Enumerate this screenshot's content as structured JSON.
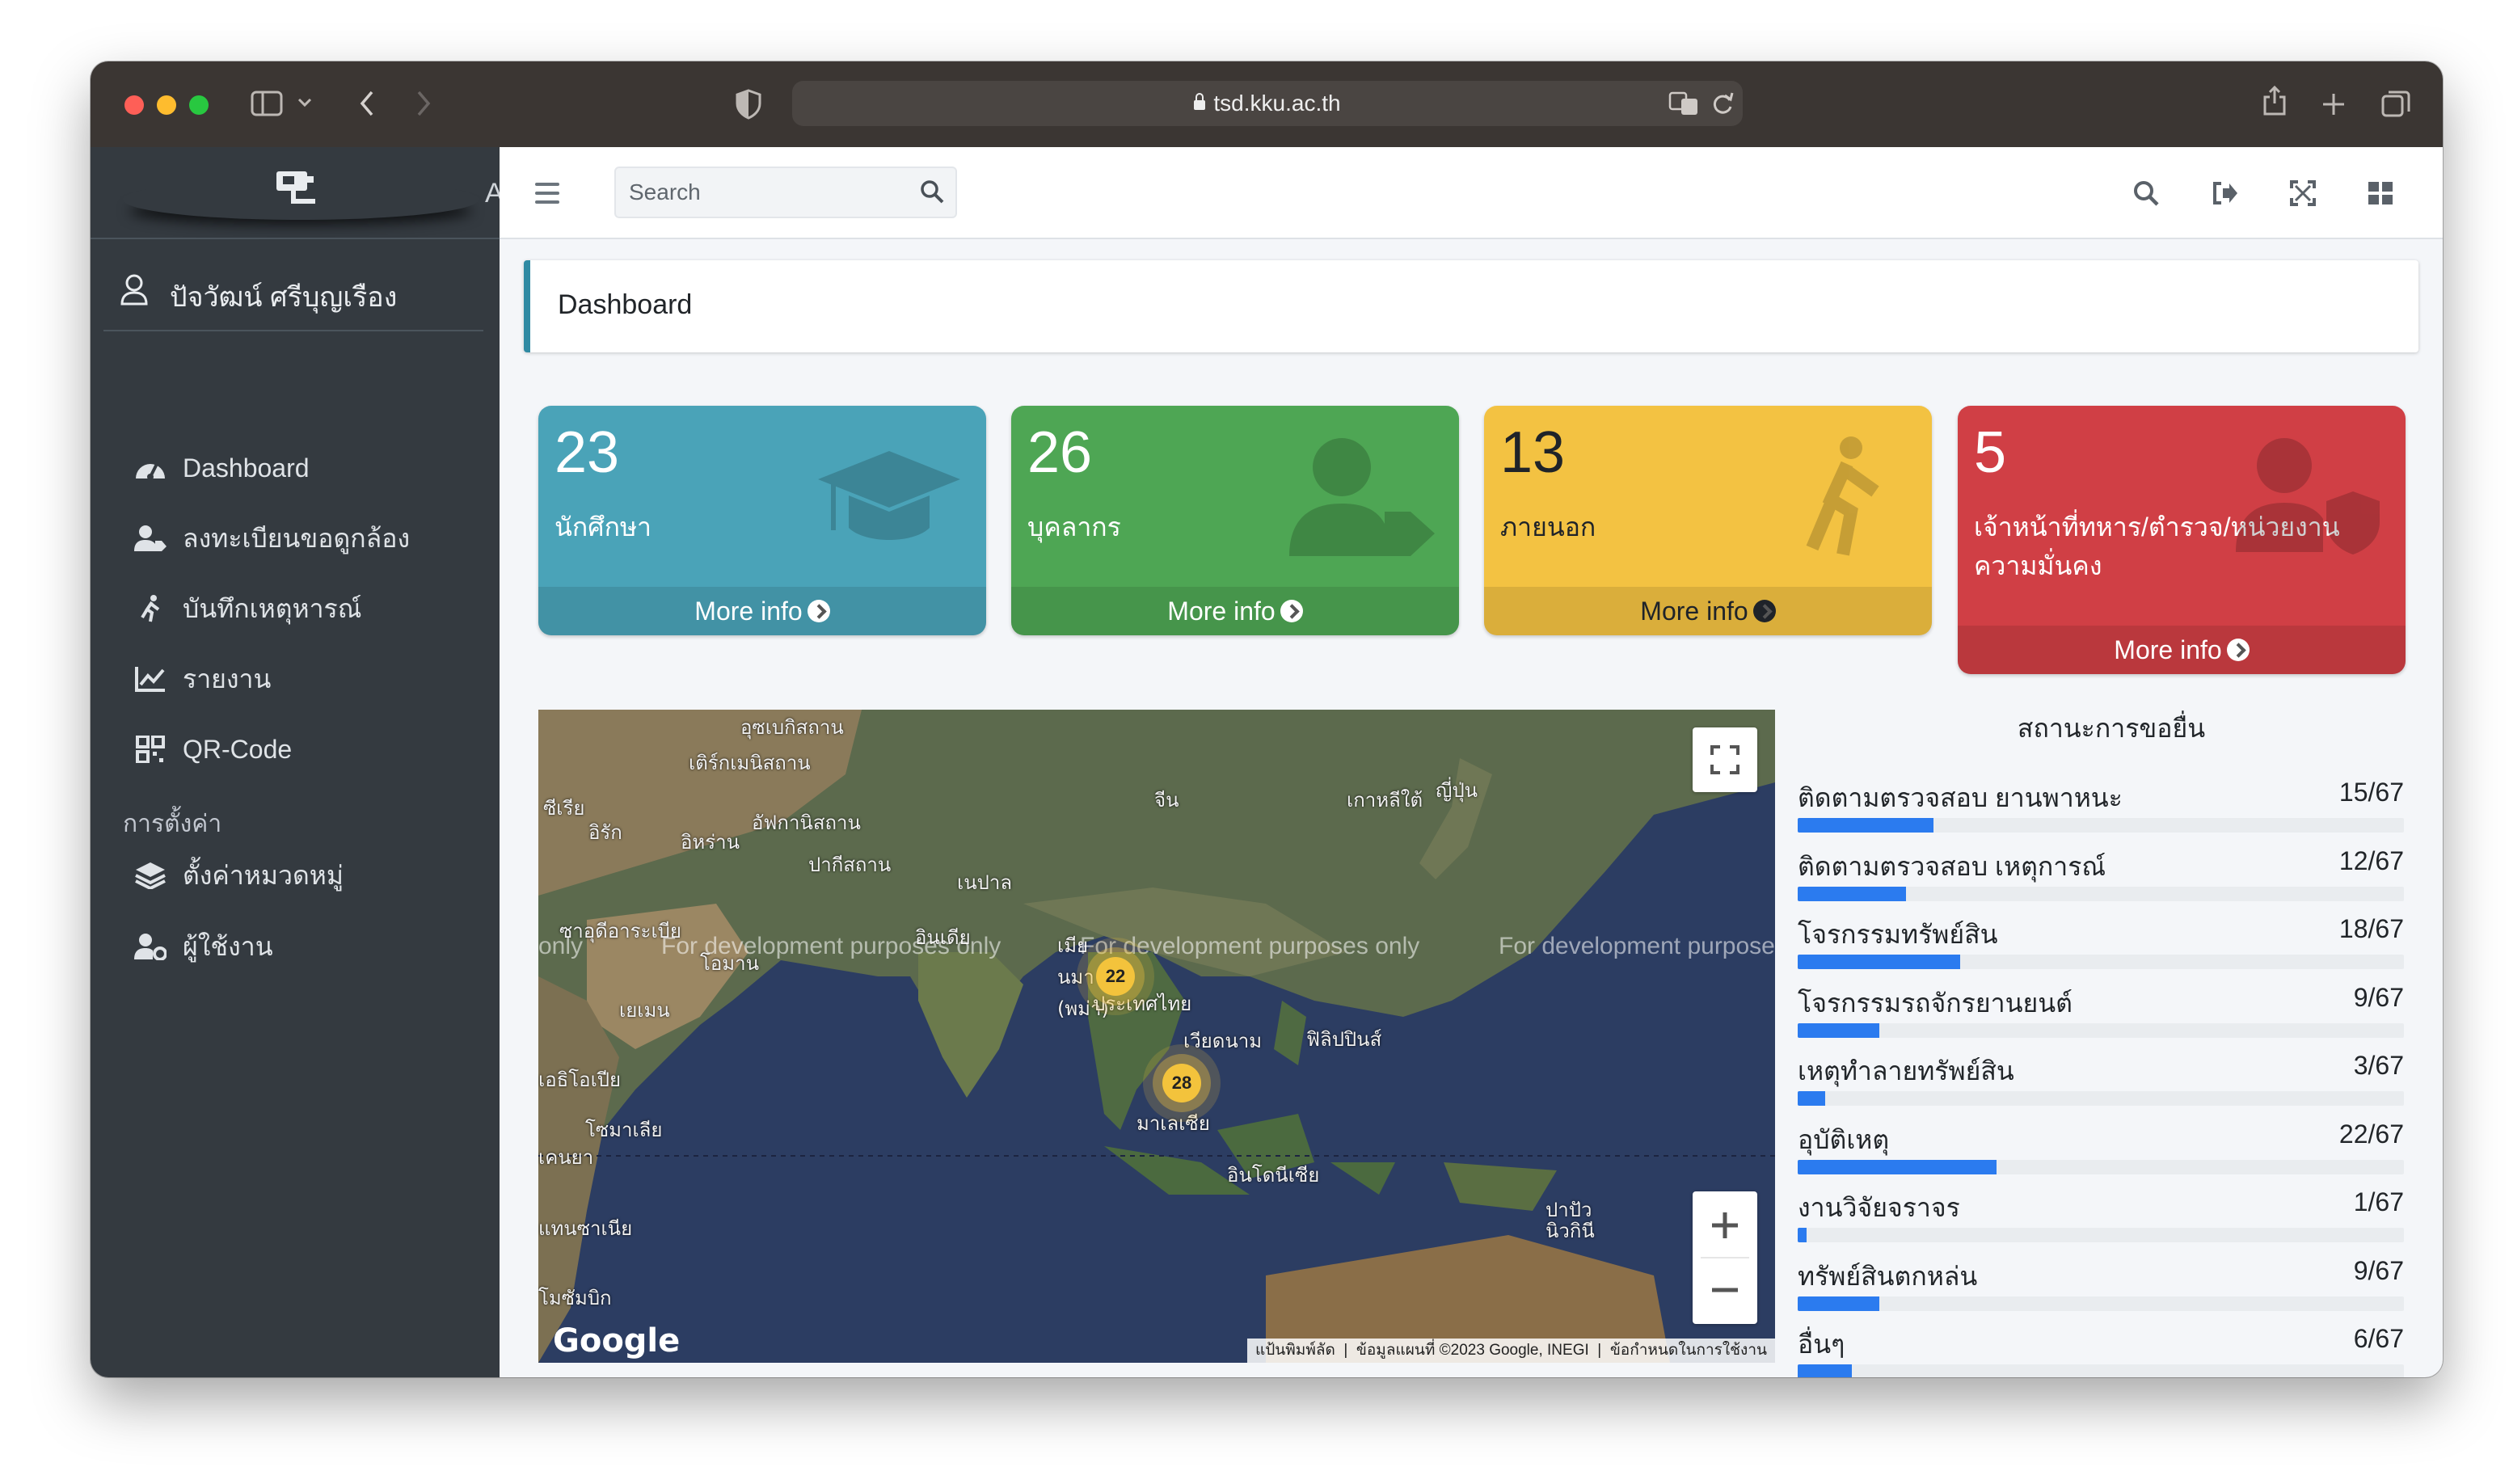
{
  "browser": {
    "url": "tsd.kku.ac.th"
  },
  "sidebar": {
    "brand_text": "A",
    "user_name": "ปัจวัฒน์ ศรีบุญเรือง",
    "items": [
      {
        "label": "Dashboard",
        "icon": "tachometer-icon"
      },
      {
        "label": "ลงทะเบียนขอดูกล้อง",
        "icon": "user-tag-icon"
      },
      {
        "label": "บันทึกเหตุหารณ์",
        "icon": "running-person-icon"
      },
      {
        "label": "รายงาน",
        "icon": "line-chart-icon"
      },
      {
        "label": "QR-Code",
        "icon": "qrcode-icon"
      }
    ],
    "settings_header": "การตั้งค่า",
    "settings_items": [
      {
        "label": "ตั้งค่าหมวดหมู่",
        "icon": "layers-icon"
      },
      {
        "label": "ผู้ใช้งาน",
        "icon": "users-cog-icon"
      }
    ]
  },
  "topbar": {
    "search_placeholder": "Search"
  },
  "page": {
    "title": "Dashboard"
  },
  "boxes": [
    {
      "count": "23",
      "label": "นักศึกษา",
      "footer": "More info",
      "color": "#4aa3b8",
      "icon": "graduation-cap-icon"
    },
    {
      "count": "26",
      "label": "บุคลากร",
      "footer": "More info",
      "color": "#4ea654",
      "icon": "user-tag-icon"
    },
    {
      "count": "13",
      "label": "ภายนอก",
      "footer": "More info",
      "color": "#f3c242",
      "icon": "walking-person-icon"
    },
    {
      "count": "5",
      "label": "เจ้าหน้าที่ทหาร/ตำรวจ/หน่วยงานความมั่นคง",
      "footer": "More info",
      "color": "#d03f45",
      "icon": "user-shield-icon"
    }
  ],
  "map": {
    "labels": {
      "uzbekistan": "อุซเบกิสถาน",
      "turkmenistan": "เติร์กเมนิสถาน",
      "syria": "ซีเรีย",
      "iraq": "อิรัก",
      "iran": "อิหร่าน",
      "afghanistan": "อัฟกานิสถาน",
      "pakistan": "ปากีสถาน",
      "nepal": "เนปาล",
      "china": "จีน",
      "south_korea": "เกาหลีใต้",
      "japan": "ญี่ปุ่น",
      "saudi": "ซาอุดีอาระเบีย",
      "oman": "โอมาน",
      "india": "อินเดีย",
      "myanmar": "เมียนมา (พม่า)",
      "yemen": "เยเมน",
      "thailand": "ประเทศไทย",
      "vietnam": "เวียดนาม",
      "philippines": "ฟิลิปปินส์",
      "ethiopia": "เอธิโอเปีย",
      "somalia": "โซมาเลีย",
      "malaysia": "มาเลเซีย",
      "kenya": "เคนยา",
      "indonesia": "อินโดนีเซีย",
      "png": "ปาปัวนิวกินี",
      "tanzania": "แทนซาเนีย",
      "mozambique": "โมซัมบิก"
    },
    "watermark": "For development purposes only",
    "watermark_left": "only",
    "watermark_right": "For development purpose",
    "clusters": [
      {
        "count": "22",
        "name": "thailand-cluster"
      },
      {
        "count": "28",
        "name": "malaysia-cluster"
      }
    ],
    "attribution": {
      "shortcuts": "แป้นพิมพ์ลัด",
      "data": "ข้อมูลแผนที่ ©2023 Google, INEGI",
      "terms": "ข้อกำหนดในการใช้งาน"
    },
    "google_logo": "Google"
  },
  "status": {
    "title": "สถานะการขอยื่น",
    "items": [
      {
        "label": "ติดตามตรวจสอบ ยานพาหนะ",
        "count": "15/67",
        "value": 15,
        "total": 67
      },
      {
        "label": "ติดตามตรวจสอบ เหตุการณ์",
        "count": "12/67",
        "value": 12,
        "total": 67
      },
      {
        "label": "โจรกรรมทรัพย์สิน",
        "count": "18/67",
        "value": 18,
        "total": 67
      },
      {
        "label": "โจรกรรมรถจักรยานยนต์",
        "count": "9/67",
        "value": 9,
        "total": 67
      },
      {
        "label": "เหตุทำลายทรัพย์สิน",
        "count": "3/67",
        "value": 3,
        "total": 67
      },
      {
        "label": "อุบัติเหตุ",
        "count": "22/67",
        "value": 22,
        "total": 67
      },
      {
        "label": "งานวิจัยจราจร",
        "count": "1/67",
        "value": 1,
        "total": 67
      },
      {
        "label": "ทรัพย์สินตกหล่น",
        "count": "9/67",
        "value": 9,
        "total": 67
      },
      {
        "label": "อื่นๆ",
        "count": "6/67",
        "value": 6,
        "total": 67
      }
    ]
  }
}
